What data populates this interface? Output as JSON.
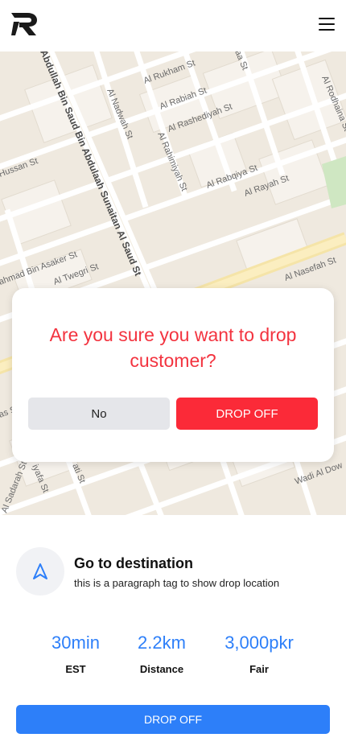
{
  "header": {
    "logo_icon": "r-logo-icon",
    "menu_icon": "hamburger-menu-icon"
  },
  "map": {
    "labels": {
      "street1": "Abdullah Bin Saud Bin Abdulaah Sunaitan Al Saud St",
      "street2": "Al Rukham St",
      "street3": "Al Rabiah St",
      "street4": "Al Rashediyah St",
      "street5": "Al Nadwah St",
      "street6": "Al Rahimiyah St",
      "street7": "Al Rabqiya St",
      "street8": "Al Rayah St",
      "street9": "Al Rodhaina St",
      "street10": "Hussan St",
      "street11": "ahmad Bin Asaker St",
      "street12": "Al Twegri St",
      "street13": "Al Nasefah St",
      "street14": "Al Sadarah St",
      "street15": "Wadi Al Dow",
      "street16": "iyafa St",
      "street17": "ati St",
      "street18": "aa St",
      "street19": "as St"
    }
  },
  "dialog": {
    "message": "Are you sure you want to drop customer?",
    "no_label": "No",
    "confirm_label": "DROP OFF"
  },
  "destination": {
    "icon": "navigation-arrow-icon",
    "title": "Go to destination",
    "subtitle": "this is a paragraph tag to show drop location"
  },
  "stats": [
    {
      "value": "30min",
      "label": "EST"
    },
    {
      "value": "2.2km",
      "label": "Distance"
    },
    {
      "value": "3,000pkr",
      "label": "Fair"
    }
  ],
  "footer": {
    "button_label": "DROP OFF"
  },
  "colors": {
    "accent_blue": "#2d7ff9",
    "danger_red": "#fb2a38",
    "map_background": "#efe9df"
  }
}
